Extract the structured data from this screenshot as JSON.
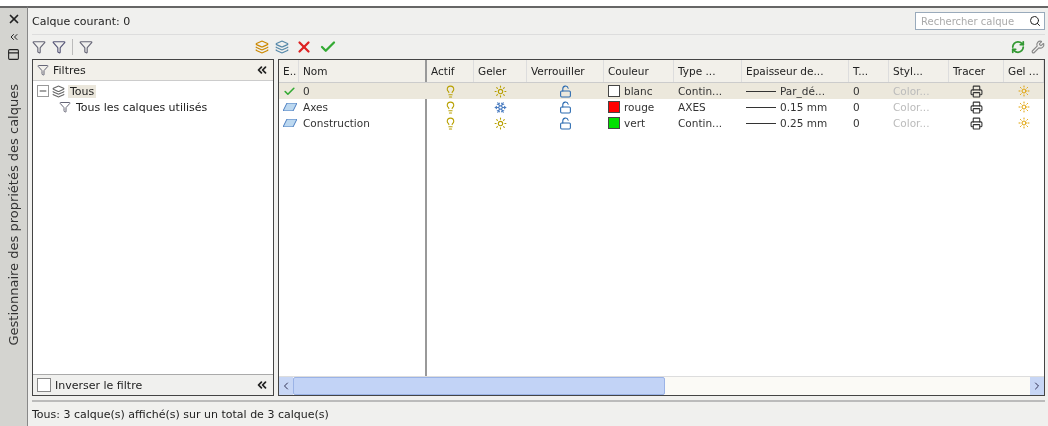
{
  "palette": {
    "title": "Gestionnaire des propriétés des calques"
  },
  "current_layer": "Calque courant: 0",
  "search": {
    "placeholder": "Rechercher calque"
  },
  "filters": {
    "title": "Filtres",
    "tree": [
      {
        "label": "Tous",
        "expanded": true,
        "selected": true,
        "children": [
          {
            "label": "Tous les calques utilisés",
            "selected": false
          }
        ]
      }
    ],
    "invert": {
      "label": "Inverser le filtre",
      "checked": false
    }
  },
  "table": {
    "columns": [
      "E..",
      "Nom",
      "Actif",
      "Geler",
      "Verrouiller",
      "Couleur",
      "Type ...",
      "Epaisseur de...",
      "T...",
      "Styl...",
      "Tracer",
      "Gel ..."
    ],
    "rows": [
      {
        "current": true,
        "selected": true,
        "name": "0",
        "on": true,
        "frozen": false,
        "locked": false,
        "color_name": "blanc",
        "color": "#ffffff",
        "linetype": "Contin...",
        "lineweight": "Par_dé...",
        "transparency": "0",
        "plot_style": "Color...",
        "plot": true
      },
      {
        "current": false,
        "selected": false,
        "name": "Axes",
        "on": true,
        "frozen": true,
        "locked": false,
        "color_name": "rouge",
        "color": "#ff0000",
        "linetype": "AXES",
        "lineweight": "0.15 mm",
        "transparency": "0",
        "plot_style": "Color...",
        "plot": true
      },
      {
        "current": false,
        "selected": false,
        "name": "Construction",
        "on": true,
        "frozen": false,
        "locked": false,
        "color_name": "vert",
        "color": "#00e000",
        "linetype": "Contin...",
        "lineweight": "0.25 mm",
        "transparency": "0",
        "plot_style": "Color...",
        "plot": true
      }
    ]
  },
  "status_bar": "Tous: 3 calque(s) affiché(s) sur un total de 3 calque(s)"
}
